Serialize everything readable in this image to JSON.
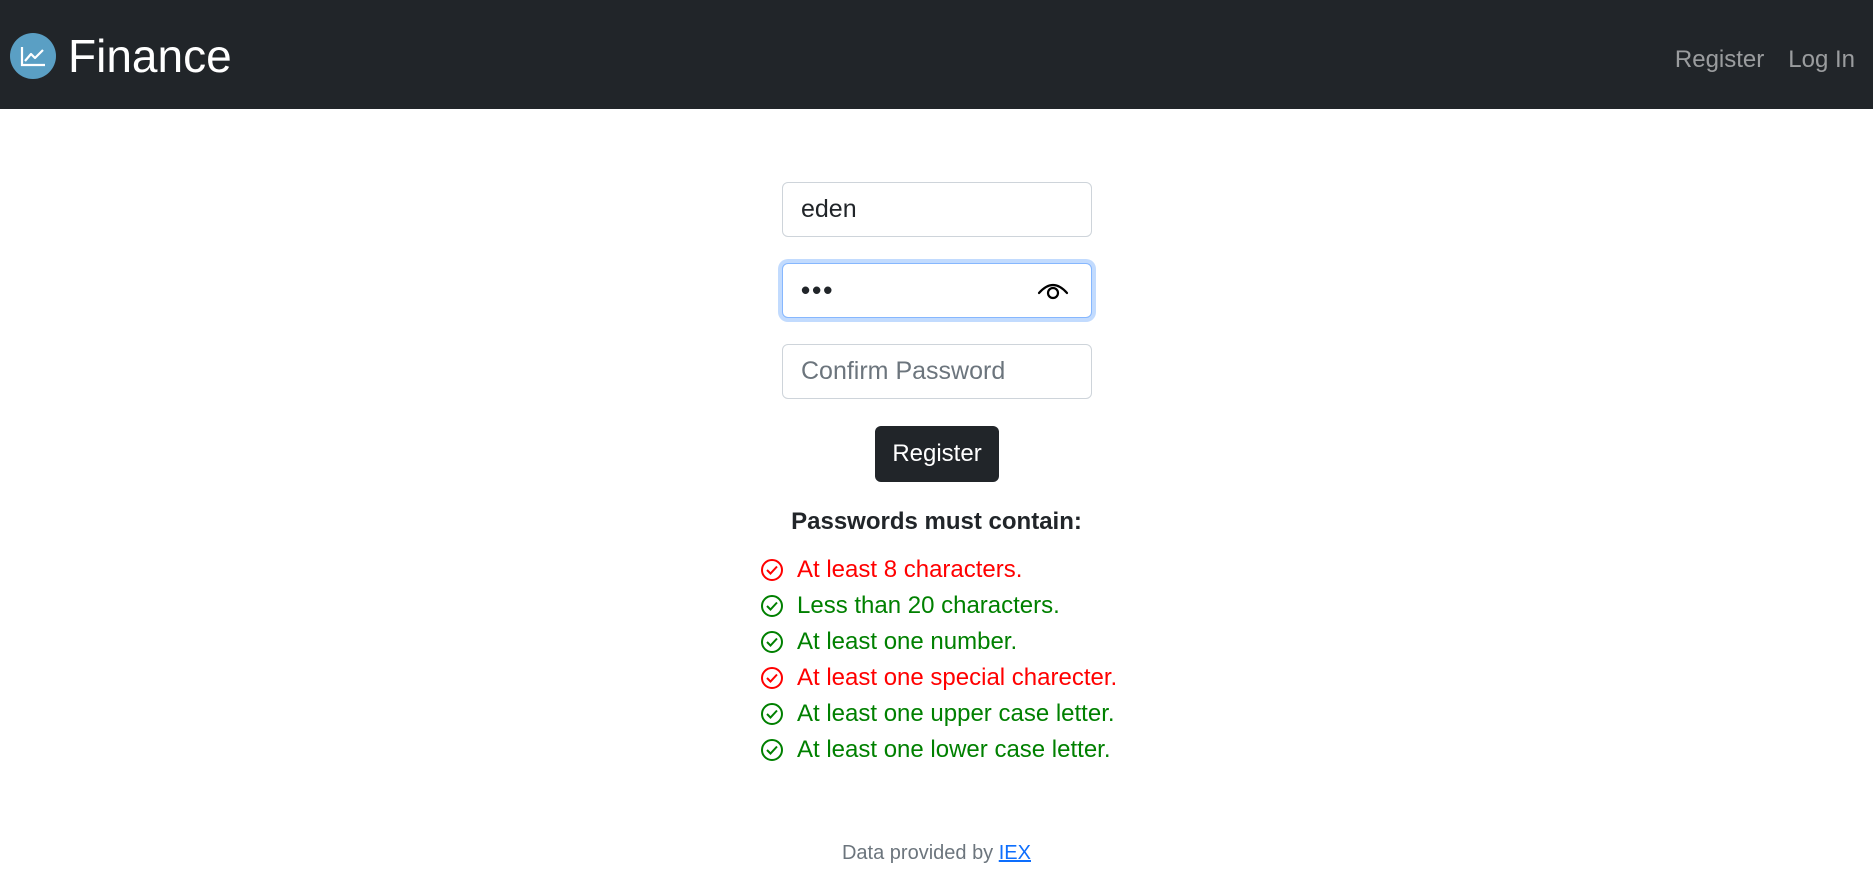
{
  "navbar": {
    "brand_icon": "chart-line-icon",
    "brand_text": "Finance",
    "links": [
      "Register",
      "Log In"
    ]
  },
  "form": {
    "username_value": "eden",
    "password_mask": "•••",
    "password_toggle_icon": "eye-icon",
    "confirm_placeholder": "Confirm Password",
    "submit_label": "Register"
  },
  "requirements": {
    "title": "Passwords must contain:",
    "items": [
      {
        "text": "At least 8 characters.",
        "status": "fail",
        "color": "#ff0000"
      },
      {
        "text": "Less than 20 characters.",
        "status": "pass",
        "color": "#008000"
      },
      {
        "text": "At least one number.",
        "status": "pass",
        "color": "#008000"
      },
      {
        "text": "At least one special charecter.",
        "status": "fail",
        "color": "#ff0000"
      },
      {
        "text": "At least one upper case letter.",
        "status": "pass",
        "color": "#008000"
      },
      {
        "text": "At least one lower case letter.",
        "status": "pass",
        "color": "#008000"
      }
    ]
  },
  "footer": {
    "prefix": "Data provided by ",
    "link_text": "IEX"
  },
  "colors": {
    "navbar_bg": "#212529",
    "fail": "#ff0000",
    "pass": "#008000",
    "link": "#0d6efd"
  }
}
